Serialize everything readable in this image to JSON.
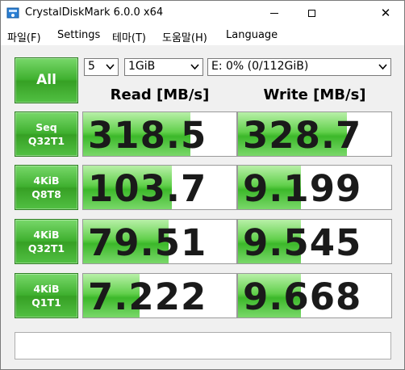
{
  "window": {
    "title": "CrystalDiskMark 6.0.0 x64"
  },
  "menu": [
    "파일(F)",
    "Settings",
    "테마(T)",
    "도움말(H)",
    "Language"
  ],
  "controls": {
    "all_label": "All",
    "count": "5",
    "size": "1GiB",
    "drive": "E: 0% (0/112GiB)"
  },
  "headers": {
    "read": "Read [MB/s]",
    "write": "Write [MB/s]"
  },
  "tests": [
    {
      "line1": "Seq",
      "line2": "Q32T1",
      "read": "318.5",
      "write": "328.7",
      "read_fill": 0.7,
      "write_fill": 0.71
    },
    {
      "line1": "4KiB",
      "line2": "Q8T8",
      "read": "103.7",
      "write": "9.199",
      "read_fill": 0.58,
      "write_fill": 0.41
    },
    {
      "line1": "4KiB",
      "line2": "Q32T1",
      "read": "79.51",
      "write": "9.545",
      "read_fill": 0.56,
      "write_fill": 0.41
    },
    {
      "line1": "4KiB",
      "line2": "Q1T1",
      "read": "7.222",
      "write": "9.668",
      "read_fill": 0.37,
      "write_fill": 0.41
    }
  ],
  "status_text": "",
  "colors": {
    "accent_green": "#3fb02f",
    "fill_green": "#62d04c"
  }
}
